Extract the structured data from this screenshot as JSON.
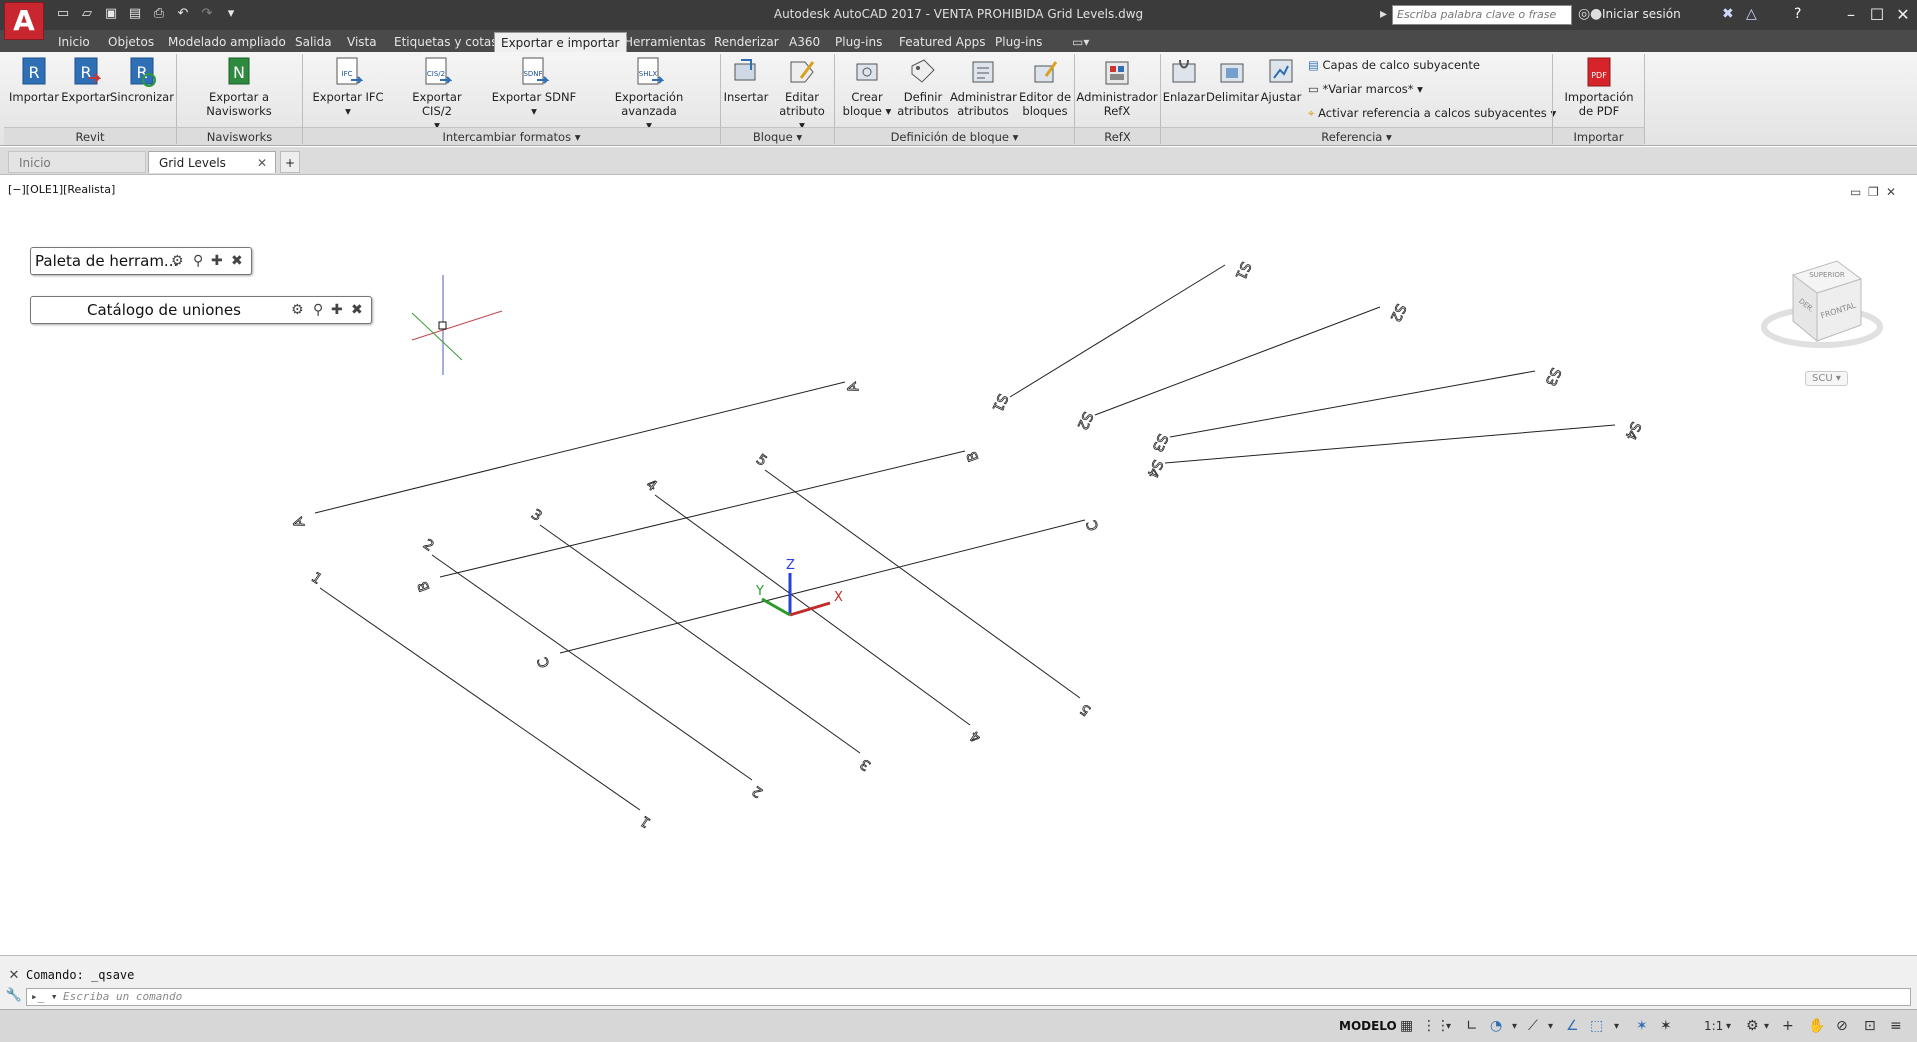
{
  "titlebar": {
    "logo": "A",
    "title": "Autodesk AutoCAD 2017 - VENTA PROHIBIDA    Grid Levels.dwg",
    "search_placeholder": "Escriba palabra clave o frase",
    "login": "Iniciar sesión"
  },
  "ribbon_tabs": [
    "Inicio",
    "Objetos",
    "Modelado ampliado",
    "Salida",
    "Vista",
    "Etiquetas y cotas",
    "Exportar e importar",
    "Herramientas",
    "Renderizar",
    "A360",
    "Plug-ins",
    "Featured Apps",
    "Plug-ins"
  ],
  "ribbon": {
    "buttons": {
      "importar": "Importar",
      "exportar": "Exportar",
      "sincronizar": "Sincronizar",
      "exportar_navisworks": "Exportar a Navisworks",
      "exportar_ifc": "Exportar IFC",
      "exportar_cis2": "Exportar CIS/2",
      "exportar_sdnf": "Exportar SDNF",
      "exportacion_avanzada": "Exportación avanzada",
      "insertar": "Insertar",
      "editar_atributo_1": "Editar",
      "editar_atributo_2": "atributo",
      "crear_bloque_1": "Crear",
      "crear_bloque_2": "bloque",
      "definir_atributos_1": "Definir",
      "definir_atributos_2": "atributos",
      "administrar_atributos_1": "Administrar",
      "administrar_atributos_2": "atributos",
      "editor_bloques_1": "Editor de",
      "editor_bloques_2": "bloques",
      "administrador_refx_1": "Administrador",
      "administrador_refx_2": "RefX",
      "enlazar": "Enlazar",
      "delimitar": "Delimitar",
      "ajustar": "Ajustar",
      "capas_calco": "Capas de calco subyacente",
      "variar_marcos": "*Variar marcos*",
      "activar_referencia": "Activar referencia a calcos subyacentes",
      "importacion_pdf_1": "Importación",
      "importacion_pdf_2": "de PDF"
    },
    "icon_tags": {
      "ifc": "IFC",
      "cis2": "CIS/2",
      "sdnf": "SDNF",
      "shlx": "SHLX",
      "pdf": "PDF"
    },
    "groups": {
      "revit": "Revit",
      "navisworks": "Navisworks",
      "intercambiar": "Intercambiar formatos",
      "bloque": "Bloque",
      "definicion": "Definición de bloque",
      "refx": "RefX",
      "referencia": "Referencia",
      "importar": "Importar"
    }
  },
  "doc_tabs": {
    "inicio": "Inicio",
    "current": "Grid Levels"
  },
  "viewport": {
    "label": "[−][OLE1][Realista]",
    "palette1": "Paleta de herram...",
    "palette2": "Catálogo de uniones",
    "scu": "SCU",
    "viewcube_top": "SUPERIOR",
    "viewcube_front": "FRONTAL",
    "viewcube_right": "DER."
  },
  "drawing": {
    "grid_numbers": [
      "1",
      "2",
      "3",
      "4",
      "5"
    ],
    "grid_letters": [
      "A",
      "B",
      "C"
    ],
    "s_labels": [
      "S1",
      "S2",
      "S3",
      "S4"
    ],
    "axis_x": "X",
    "axis_y": "Y",
    "axis_z": "Z"
  },
  "command": {
    "history": "Comando:  _qsave",
    "placeholder": "Escriba un comando"
  },
  "status": {
    "model": "MODELO",
    "scale": "1:1"
  }
}
